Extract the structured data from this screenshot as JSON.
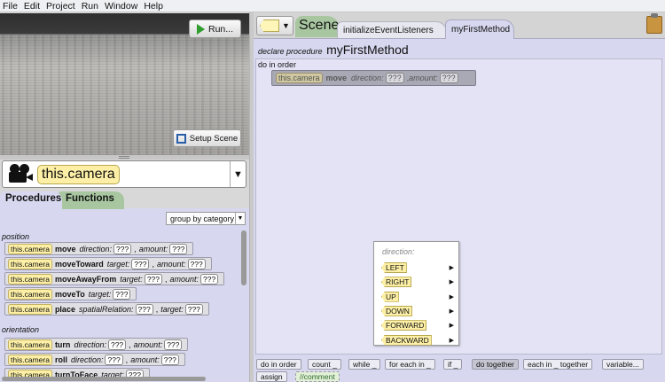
{
  "menu": [
    "File",
    "Edit",
    "Project",
    "Run",
    "Window",
    "Help"
  ],
  "scene_view": {
    "run_label": "Run...",
    "setup_label": "Setup Scene"
  },
  "selector": {
    "label": "this.camera"
  },
  "palette": {
    "tabs": {
      "procedures": "Procedures",
      "functions": "Functions"
    },
    "group_by": "group by category",
    "categories": {
      "position": "position",
      "orientation": "orientation"
    },
    "blocks": [
      {
        "this": "this.camera",
        "method": "move",
        "params": [
          {
            "name": "direction:",
            "value": "???"
          },
          {
            "name": "amount:",
            "value": "???"
          }
        ]
      },
      {
        "this": "this.camera",
        "method": "moveToward",
        "params": [
          {
            "name": "target:",
            "value": "???"
          },
          {
            "name": "amount:",
            "value": "???"
          }
        ]
      },
      {
        "this": "this.camera",
        "method": "moveAwayFrom",
        "params": [
          {
            "name": "target:",
            "value": "???"
          },
          {
            "name": "amount:",
            "value": "???"
          }
        ]
      },
      {
        "this": "this.camera",
        "method": "moveTo",
        "params": [
          {
            "name": "target:",
            "value": "???"
          }
        ]
      },
      {
        "this": "this.camera",
        "method": "place",
        "params": [
          {
            "name": "spatialRelation:",
            "value": "???"
          },
          {
            "name": "target:",
            "value": "???"
          }
        ]
      },
      {
        "this": "this.camera",
        "method": "turn",
        "params": [
          {
            "name": "direction:",
            "value": "???"
          },
          {
            "name": "amount:",
            "value": "???"
          }
        ]
      },
      {
        "this": "this.camera",
        "method": "roll",
        "params": [
          {
            "name": "direction:",
            "value": "???"
          },
          {
            "name": "amount:",
            "value": "???"
          }
        ]
      },
      {
        "this": "this.camera",
        "method": "turnToFace",
        "params": [
          {
            "name": "target:",
            "value": "???"
          }
        ]
      }
    ]
  },
  "editor": {
    "tabs": {
      "scene": "Scene",
      "init": "initializeEventListeners",
      "first": "myFirstMethod"
    },
    "declare": "declare procedure",
    "procedure_name": "myFirstMethod",
    "do_in_order": "do in order",
    "statement": {
      "this": "this.camera",
      "method": "move",
      "p1": "direction:",
      "v1": "???",
      "p2": "amount:",
      "v2": "???"
    },
    "menu_header": "direction:",
    "directions": [
      "LEFT",
      "RIGHT",
      "UP",
      "DOWN",
      "FORWARD",
      "BACKWARD"
    ]
  },
  "controls": [
    "do in order",
    "count _",
    "while _",
    "for each in _",
    "if _",
    "do together",
    "each in _ together",
    "variable...",
    "assign",
    "//comment"
  ],
  "colors": {
    "scene_tab": "#a8c7a0",
    "method_tab": "#d7d7ef",
    "this_chip": "#fdf0a6"
  }
}
